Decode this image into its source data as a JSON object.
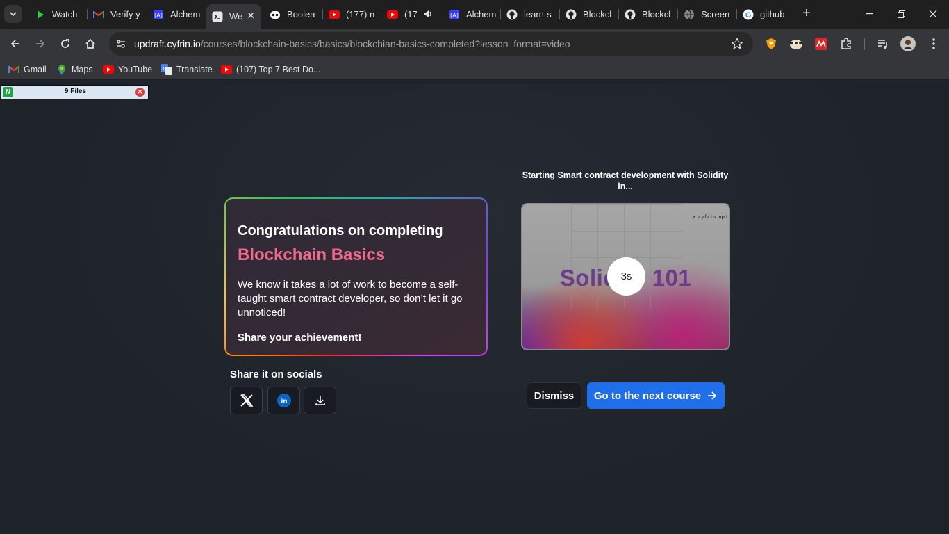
{
  "browser": {
    "tabs": [
      {
        "title": "Watch",
        "icon": "play-icon"
      },
      {
        "title": "Verify y",
        "icon": "gmail-icon"
      },
      {
        "title": "Alchem",
        "icon": "alchemy-icon"
      },
      {
        "title": "We",
        "icon": "terminal-icon",
        "active": true
      },
      {
        "title": "Boolea",
        "icon": "bot-icon"
      },
      {
        "title": "(177) n",
        "icon": "youtube-icon"
      },
      {
        "title": "(17",
        "icon": "youtube-icon"
      },
      {
        "title": "Alchem",
        "icon": "alchemy-icon"
      },
      {
        "title": "learn-s",
        "icon": "github-icon"
      },
      {
        "title": "Blockcl",
        "icon": "github-icon"
      },
      {
        "title": "Blockcl",
        "icon": "github-icon"
      },
      {
        "title": "Screen",
        "icon": "globe-icon"
      },
      {
        "title": "github",
        "icon": "google-icon"
      }
    ],
    "url_host": "updraft.cyfrin.io",
    "url_path": "/courses/blockchain-basics/basics/blockchian-basics-completed?lesson_format=video",
    "bookmarks": [
      {
        "label": "Gmail",
        "icon": "gmail-icon"
      },
      {
        "label": "Maps",
        "icon": "maps-icon"
      },
      {
        "label": "YouTube",
        "icon": "youtube-icon"
      },
      {
        "label": "Translate",
        "icon": "translate-icon"
      },
      {
        "label": "(107) Top 7 Best Do...",
        "icon": "youtube-icon"
      }
    ]
  },
  "files_widget": {
    "label": "9 Files"
  },
  "card": {
    "heading": "Congratulations on completing",
    "course": "Blockchain Basics",
    "body": "We know it takes a lot of work to become a self-taught smart contract developer, so don’t let it go unnoticed!",
    "share_cta": "Share your achievement!"
  },
  "socials": {
    "title": "Share it on socials",
    "buttons": [
      "x-icon",
      "linkedin-icon",
      "download-icon"
    ]
  },
  "next_course": {
    "title": "Starting Smart contract development with Solidity in...",
    "video_text": "Solidity 101",
    "terminal_text": "> cyfrin upd",
    "countdown": "3s"
  },
  "actions": {
    "dismiss": "Dismiss",
    "next": "Go to the next course"
  },
  "colors": {
    "accent": "#1f6feb",
    "course_title": "#ef6a8a"
  }
}
